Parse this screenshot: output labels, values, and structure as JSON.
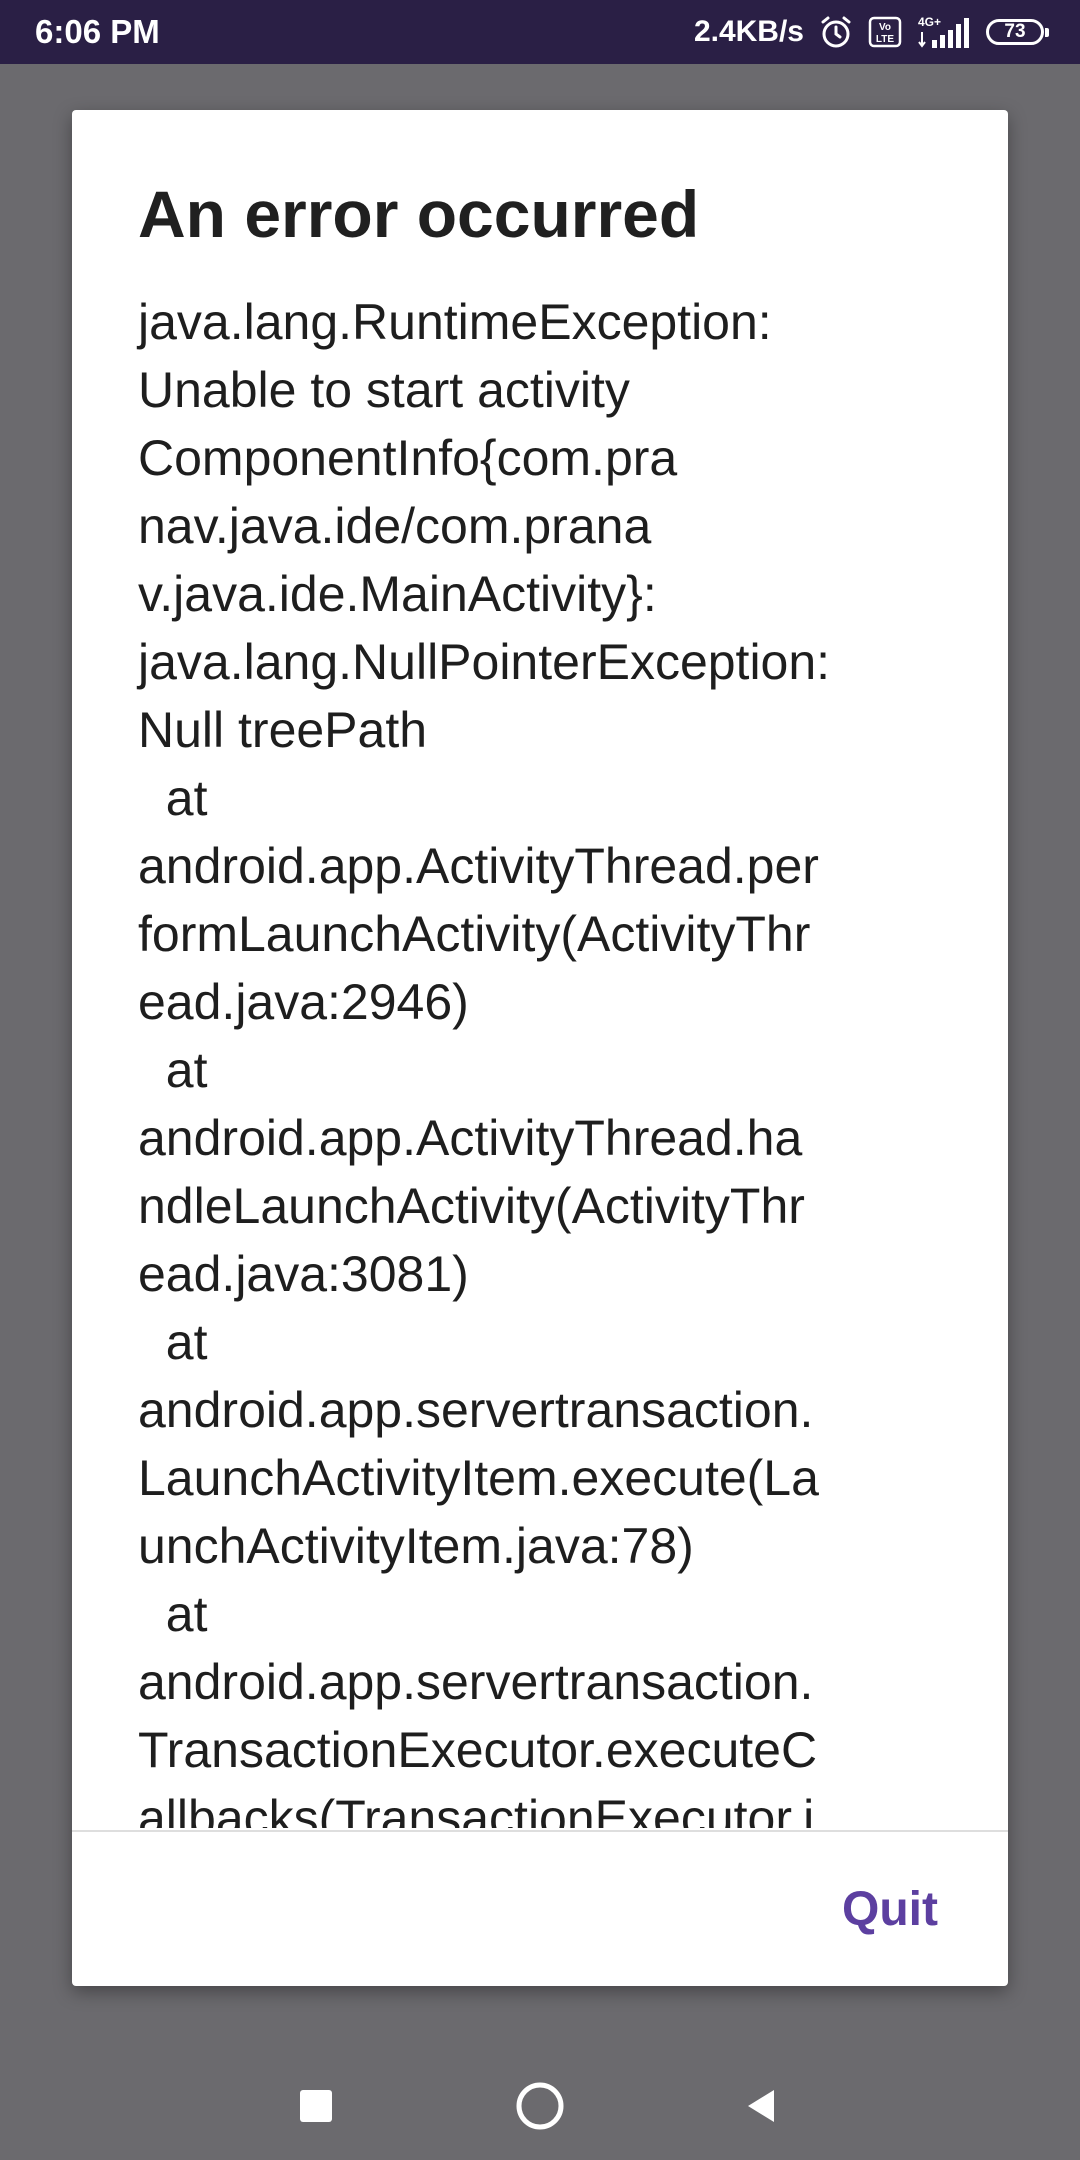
{
  "status_bar": {
    "time": "6:06 PM",
    "net_speed": "2.4KB/s",
    "volte_label": "Vo LTE",
    "network_label": "4G+",
    "battery_level": "73"
  },
  "dialog": {
    "title": "An error occurred",
    "message": "java.lang.RuntimeException:\nUnable to start activity\nComponentInfo{com.pra\nnav.java.ide/com.prana\nv.java.ide.MainActivity}:\njava.lang.NullPointerException:\nNull treePath\n  at\nandroid.app.ActivityThread.per\nformLaunchActivity(ActivityThr\nead.java:2946)\n  at\nandroid.app.ActivityThread.ha\nndleLaunchActivity(ActivityThr\nead.java:3081)\n  at\nandroid.app.servertransaction.\nLaunchActivityItem.execute(La\nunchActivityItem.java:78)\n  at\nandroid.app.servertransaction.\nTransactionExecutor.executeC\nallbacks(TransactionExecutor.j",
    "quit_label": "Quit"
  },
  "colors": {
    "status_bar_bg": "#2a1f45",
    "accent": "#5c3fa0",
    "scrim": "#6b6a6e"
  },
  "icons": {
    "alarm": "alarm-icon",
    "signal": "signal-icon",
    "recent": "recent-apps-icon",
    "home": "home-icon",
    "back": "back-icon"
  }
}
